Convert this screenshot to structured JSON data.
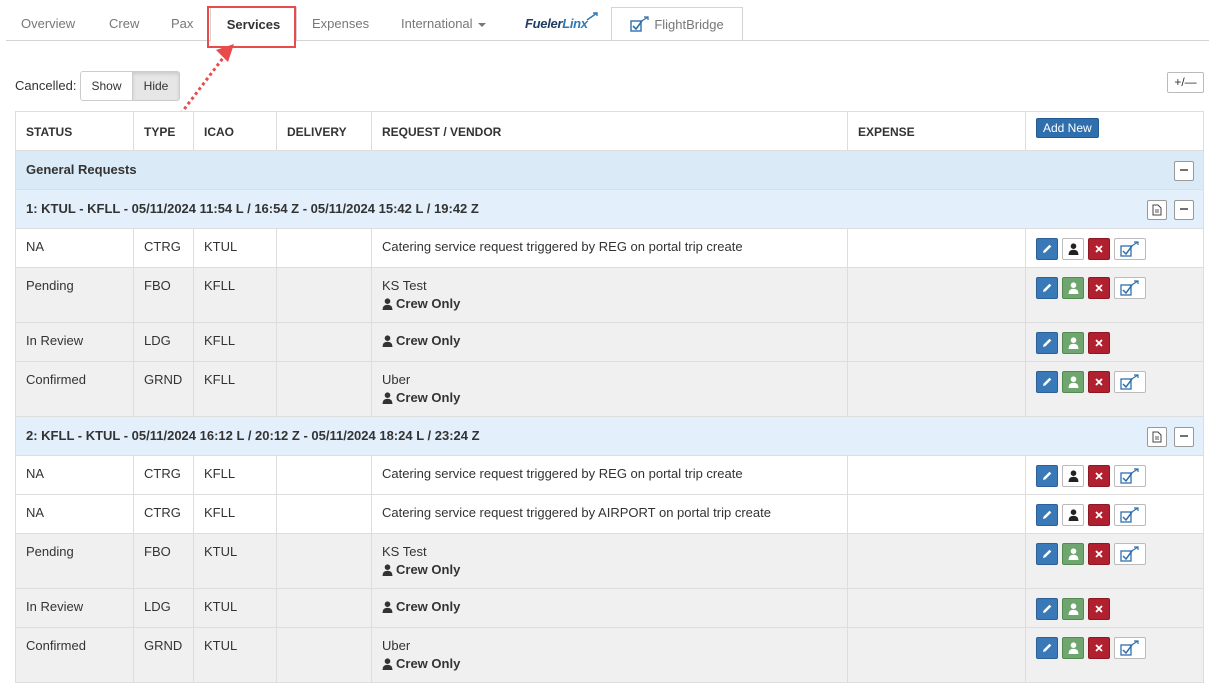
{
  "tabs": [
    {
      "label": "Overview"
    },
    {
      "label": "Crew"
    },
    {
      "label": "Pax"
    },
    {
      "label": "Services"
    },
    {
      "label": "Expenses"
    },
    {
      "label": "International"
    },
    {
      "label_main": "Fueler",
      "label_accent": "Linx"
    },
    {
      "label": "FlightBridge"
    }
  ],
  "cancelled": {
    "label": "Cancelled:",
    "show": "Show",
    "hide": "Hide"
  },
  "expand_toggle": "+/—",
  "columns": [
    "STATUS",
    "TYPE",
    "ICAO",
    "DELIVERY",
    "REQUEST / VENDOR",
    "EXPENSE"
  ],
  "add_new": "Add New",
  "general_requests": "General Requests",
  "legs": [
    {
      "title": "1: KTUL - KFLL - 05/11/2024 11:54 L / 16:54 Z - 05/11/2024 15:42 L / 19:42 Z",
      "rows": [
        {
          "status": "NA",
          "type": "CTRG",
          "icao": "KTUL",
          "request": "Catering service request triggered by REG on portal trip create",
          "crew": ""
        },
        {
          "status": "Pending",
          "type": "FBO",
          "icao": "KFLL",
          "request": "KS Test",
          "crew": "Crew Only"
        },
        {
          "status": "In Review",
          "type": "LDG",
          "icao": "KFLL",
          "request": "",
          "crew": "Crew Only"
        },
        {
          "status": "Confirmed",
          "type": "GRND",
          "icao": "KFLL",
          "request": "Uber",
          "crew": "Crew Only"
        }
      ]
    },
    {
      "title": "2: KFLL - KTUL - 05/11/2024 16:12 L / 20:12 Z - 05/11/2024 18:24 L / 23:24 Z",
      "rows": [
        {
          "status": "NA",
          "type": "CTRG",
          "icao": "KFLL",
          "request": "Catering service request triggered by REG on portal trip create",
          "crew": ""
        },
        {
          "status": "NA",
          "type": "CTRG",
          "icao": "KFLL",
          "request": "Catering service request triggered by AIRPORT on portal trip create",
          "crew": ""
        },
        {
          "status": "Pending",
          "type": "FBO",
          "icao": "KTUL",
          "request": "KS Test",
          "crew": "Crew Only"
        },
        {
          "status": "In Review",
          "type": "LDG",
          "icao": "KTUL",
          "request": "",
          "crew": "Crew Only"
        },
        {
          "status": "Confirmed",
          "type": "GRND",
          "icao": "KTUL",
          "request": "Uber",
          "crew": "Crew Only"
        }
      ]
    }
  ],
  "colors": {
    "accent_blue": "#3a79b8",
    "delete_red": "#b1202f",
    "assign_green": "#6fa66f",
    "group_bg": "#daeaf7",
    "annotation_red": "#e84b4b"
  }
}
